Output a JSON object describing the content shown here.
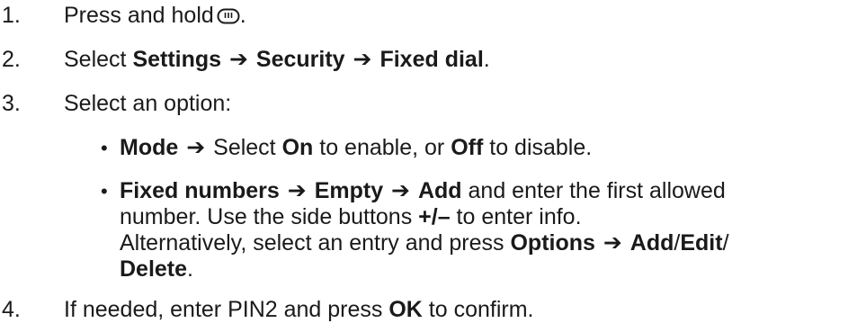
{
  "steps": [
    {
      "number": "1.",
      "text": "Press and hold",
      "key_icon": "menu-key-icon",
      "end": "."
    },
    {
      "number": "2.",
      "lead": "Select ",
      "path": [
        "Settings",
        "Security",
        "Fixed dial"
      ],
      "end": "."
    },
    {
      "number": "3.",
      "text": "Select an option:"
    },
    {
      "number": "4.",
      "lead": "If needed, enter PIN2 and press ",
      "bold": "OK",
      "tail": " to confirm."
    }
  ],
  "options": [
    {
      "bullet": "•",
      "title": "Mode",
      "lead": "Select ",
      "on": "On",
      "mid": " to enable, or ",
      "off": "Off",
      "tail": " to disable."
    },
    {
      "bullet": "•",
      "path": [
        "Fixed numbers",
        "Empty",
        "Add"
      ],
      "line1_tail": " and enter the first allowed",
      "line2_lead": "number. Use the side buttons ",
      "line2_bold": "+/–",
      "line2_tail": " to enter info.",
      "line3_lead": "Alternatively, select an entry and press ",
      "line3_bold1": "Options",
      "line3_bold2": "Add",
      "line3_sep": "/",
      "line3_bold3": "Edit",
      "line3_end": "/",
      "line4_bold": "Delete",
      "line4_end": "."
    }
  ],
  "arrow": "➔"
}
